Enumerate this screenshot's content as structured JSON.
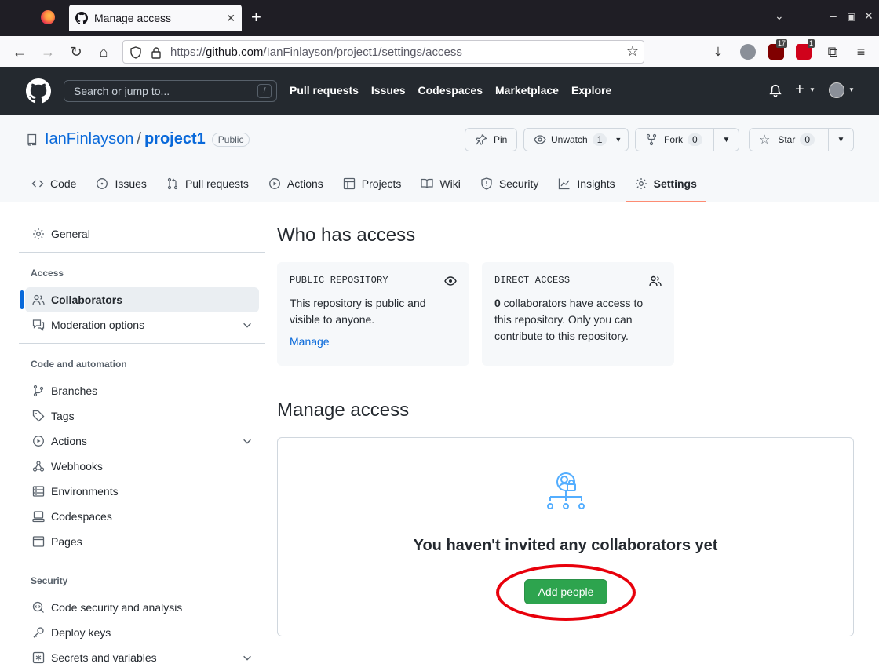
{
  "browser": {
    "tab_title": "Manage access",
    "url_prefix": "https://",
    "url_domain": "github.com",
    "url_path": "/IanFinlayson/project1/settings/access",
    "ext_badges": [
      "17",
      "1"
    ]
  },
  "gh": {
    "search_placeholder": "Search or jump to...",
    "slash": "/",
    "nav": [
      "Pull requests",
      "Issues",
      "Codespaces",
      "Marketplace",
      "Explore"
    ]
  },
  "repo": {
    "owner": "IanFinlayson",
    "sep": "/",
    "name": "project1",
    "visibility": "Public",
    "pin": "Pin",
    "unwatch": "Unwatch",
    "unwatch_count": "1",
    "fork": "Fork",
    "fork_count": "0",
    "star": "Star",
    "star_count": "0",
    "tabs": [
      "Code",
      "Issues",
      "Pull requests",
      "Actions",
      "Projects",
      "Wiki",
      "Security",
      "Insights",
      "Settings"
    ],
    "selected_tab": "Settings"
  },
  "sidebar": {
    "general": "General",
    "access_head": "Access",
    "collaborators": "Collaborators",
    "moderation": "Moderation options",
    "code_head": "Code and automation",
    "branches": "Branches",
    "tags": "Tags",
    "actions": "Actions",
    "webhooks": "Webhooks",
    "environments": "Environments",
    "codespaces": "Codespaces",
    "pages": "Pages",
    "security_head": "Security",
    "code_security": "Code security and analysis",
    "deploy_keys": "Deploy keys",
    "secrets": "Secrets and variables"
  },
  "main": {
    "who_title": "Who has access",
    "public_card": {
      "title": "PUBLIC REPOSITORY",
      "body": "This repository is public and visible to anyone.",
      "link": "Manage"
    },
    "direct_card": {
      "title": "DIRECT ACCESS",
      "count": "0",
      "body": " collaborators have access to this repository. Only you can contribute to this repository."
    },
    "manage_title": "Manage access",
    "empty_text": "You haven't invited any collaborators yet",
    "add_button": "Add people"
  },
  "colors": {
    "accent": "#0969da",
    "green": "#2da44e",
    "highlight_ring": "#e8000b",
    "tab_underline": "#fd8c73"
  }
}
